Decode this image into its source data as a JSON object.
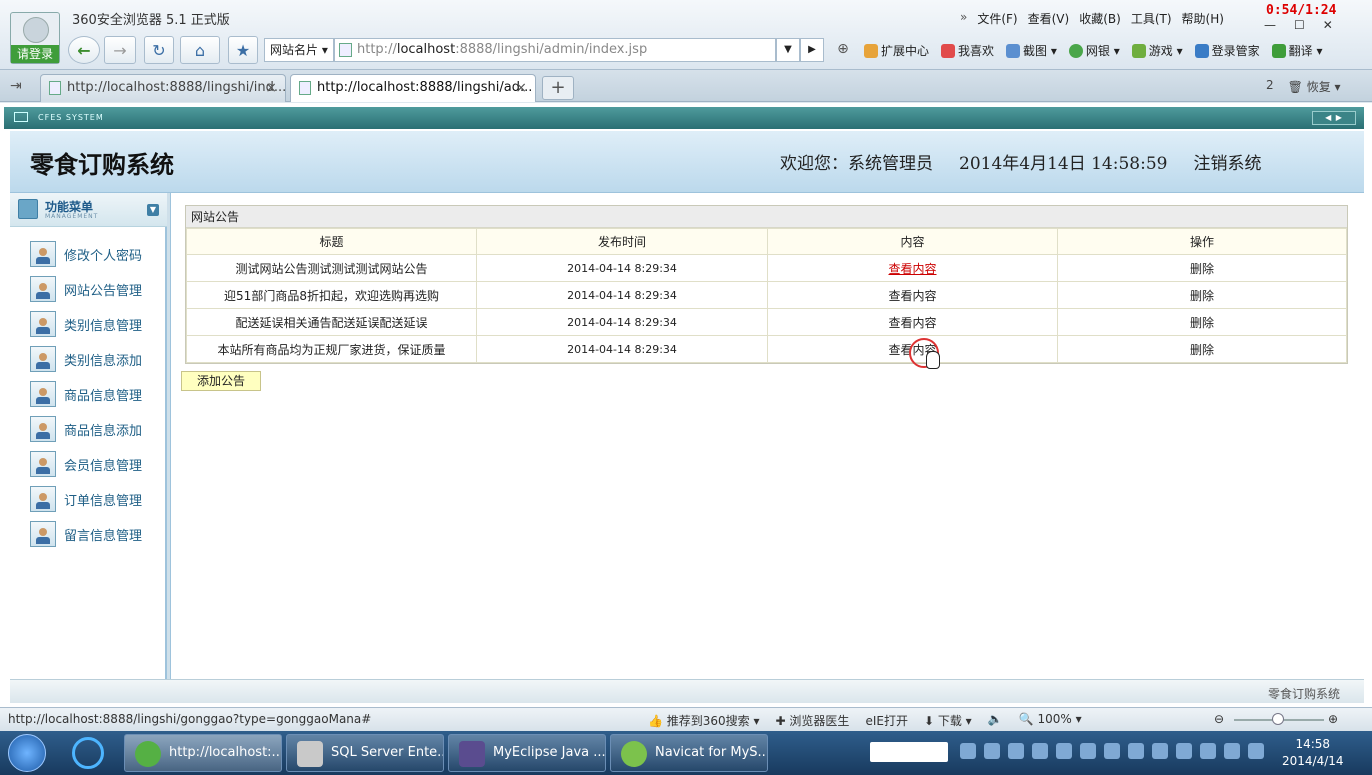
{
  "browser": {
    "title": "360安全浏览器 5.1 正式版",
    "login_label": "请登录",
    "recording_timer": "0:54/1:24",
    "menu": [
      "文件(F)",
      "查看(V)",
      "收藏(B)",
      "工具(T)",
      "帮助(H)"
    ],
    "site_names_label": "网站名片",
    "url_prefix": "http://",
    "url_host": "localhost",
    "url_rest": ":8888/lingshi/admin/index.jsp",
    "toolbar_links": [
      "扩展中心",
      "我喜欢",
      "截图",
      "网银",
      "游戏",
      "登录管家",
      "翻译"
    ],
    "tabs": [
      {
        "label": "http://localhost:8888/lingshi/ind...",
        "close": "×"
      },
      {
        "label": "http://localhost:8888/lingshi/ad...",
        "close": "×"
      }
    ],
    "new_tab": "+",
    "tab_count": "2",
    "restore_label": "恢复"
  },
  "page": {
    "cfes_label": "CFES SYSTEM",
    "system_title": "零食订购系统",
    "welcome": "欢迎您：系统管理员",
    "datetime": "2014年4月14日  14:58:59",
    "logout": "注销系统",
    "menu_header": {
      "title": "功能菜单",
      "subtitle": "MANAGEMENT"
    },
    "menu_items": [
      "修改个人密码",
      "网站公告管理",
      "类别信息管理",
      "类别信息添加",
      "商品信息管理",
      "商品信息添加",
      "会员信息管理",
      "订单信息管理",
      "留言信息管理"
    ],
    "panel_title": "网站公告",
    "table": {
      "headers": [
        "标题",
        "发布时间",
        "内容",
        "操作"
      ],
      "rows": [
        {
          "title": "测试网站公告测试测试测试网站公告",
          "time": "2014-04-14 8:29:34",
          "content": "查看内容",
          "action": "删除"
        },
        {
          "title": "迎51部门商品8折扣起，欢迎选购再选购",
          "time": "2014-04-14 8:29:34",
          "content": "查看内容",
          "action": "删除"
        },
        {
          "title": "配送延误相关通告配送延误配送延误",
          "time": "2014-04-14 8:29:34",
          "content": "查看内容",
          "action": "删除"
        },
        {
          "title": "本站所有商品均为正规厂家进货，保证质量",
          "time": "2014-04-14 8:29:34",
          "content": "查看内容",
          "action": "删除"
        }
      ]
    },
    "add_button": "添加公告",
    "footer": "零食订购系统"
  },
  "statusbar": {
    "url": "http://localhost:8888/lingshi/gonggao?type=gonggaoMana#",
    "tools": [
      "推荐到360搜索",
      "浏览器医生",
      "IE打开",
      "下载"
    ],
    "zoom": "100%"
  },
  "taskbar": {
    "tasks": [
      "http://localhost:...",
      "SQL Server Ente...",
      "MyEclipse Java ...",
      "Navicat for MyS..."
    ],
    "time": "14:58",
    "date": "2014/4/14"
  }
}
